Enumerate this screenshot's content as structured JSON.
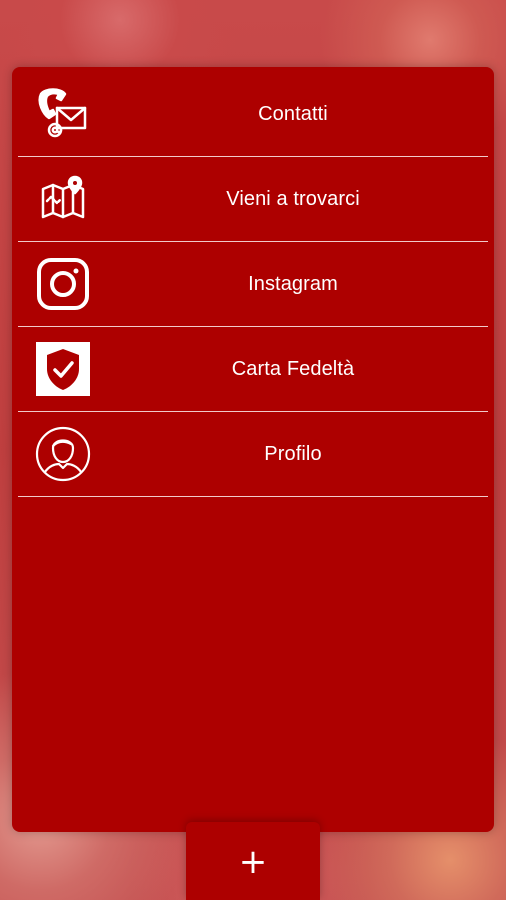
{
  "colors": {
    "panel": "#ad0000",
    "divider": "#f1c9c9",
    "text": "#ffffff"
  },
  "menu": {
    "items": [
      {
        "label": "Contatti",
        "icon": "phone-mail-icon"
      },
      {
        "label": "Vieni a trovarci",
        "icon": "map-icon"
      },
      {
        "label": "Instagram",
        "icon": "instagram-icon"
      },
      {
        "label": "Carta Fedeltà",
        "icon": "shield-check-icon"
      },
      {
        "label": "Profilo",
        "icon": "profile-icon"
      }
    ]
  },
  "fab": {
    "label": "+",
    "icon": "plus-icon"
  }
}
